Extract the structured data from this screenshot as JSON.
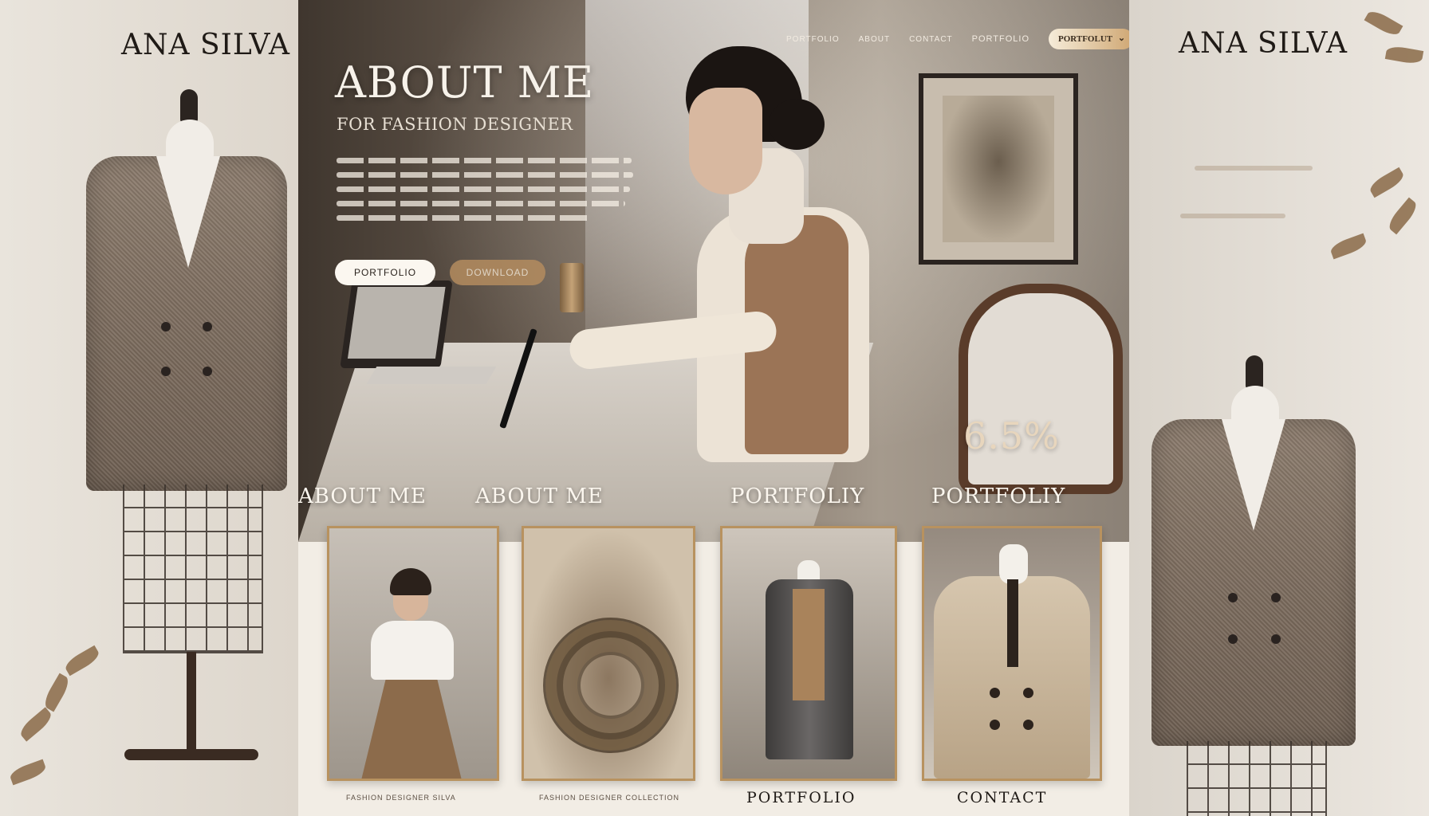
{
  "brand": {
    "name": "ANA SILVA"
  },
  "nav": {
    "items": [
      "PORTFOLIO",
      "ABOUT",
      "CONTACT",
      "PORTFOLIO"
    ],
    "cta": "PORTFOLUT"
  },
  "hero": {
    "title": "ABOUT ME",
    "subtitle": "FOR FASHION DESIGNER",
    "btn_primary": "PORTFOLIO",
    "btn_secondary": "DOWNLOAD",
    "stat": "6.5%"
  },
  "section_labels": [
    "ABOUT ME",
    "ABOUT ME",
    "PORTFOLIY",
    "PORTFOLIY"
  ],
  "cards": {
    "captions": [
      "FASHION DESIGNER SILVA",
      "FASHION DESIGNER COLLECTION",
      "PORTFOLIO",
      "CONTACT"
    ]
  },
  "colors": {
    "accent_gold": "#b8925f",
    "text_dark": "#1f1a16",
    "hero_text": "#f7f2ea",
    "background": "#ede7df"
  }
}
